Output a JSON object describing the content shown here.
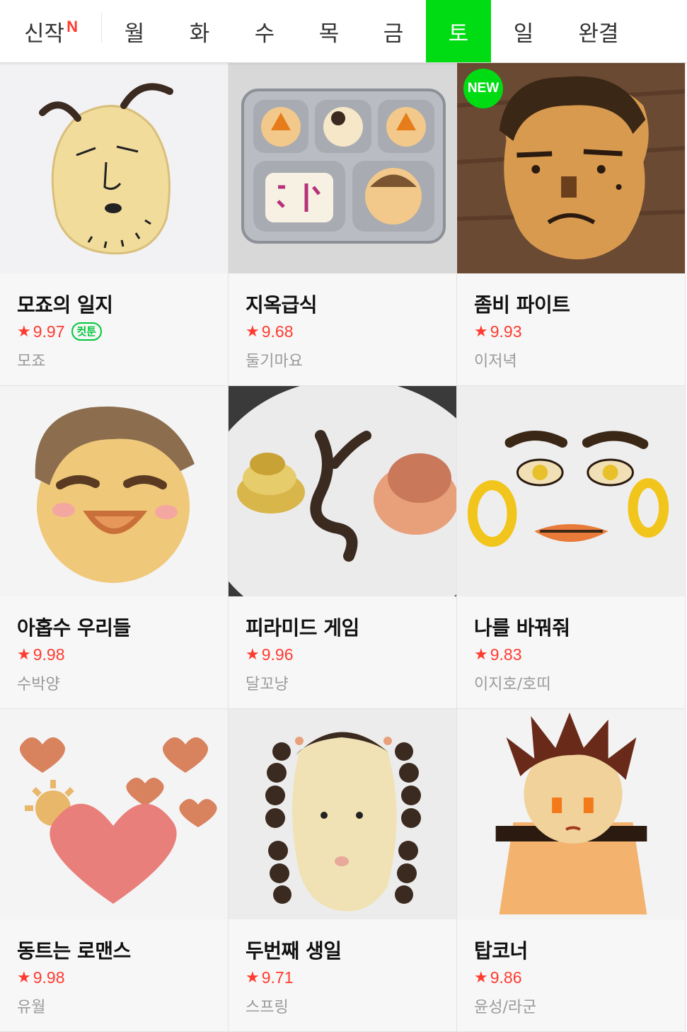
{
  "tabs": {
    "new_label": "신작",
    "new_mark": "N",
    "days": [
      "월",
      "화",
      "수",
      "목",
      "금",
      "토",
      "일",
      "완결"
    ],
    "active": "토"
  },
  "webtoons": [
    {
      "title": "모죠의 일지",
      "rating": "9.97",
      "badge": "컷툰",
      "author": "모죠",
      "thumb": "potato-face-cookie"
    },
    {
      "title": "지옥급식",
      "rating": "9.68",
      "author": "둘기마요",
      "thumb": "lunch-tray-cookies"
    },
    {
      "title": "좀비 파이트",
      "rating": "9.93",
      "author": "이저녁",
      "thumb": "angry-face-cookie",
      "new_label": "NEW"
    },
    {
      "title": "아홉수 우리들",
      "rating": "9.98",
      "author": "수박양",
      "thumb": "smiling-boy-cookie"
    },
    {
      "title": "피라미드 게임",
      "rating": "9.96",
      "author": "달꼬냥",
      "thumb": "plate-cookies"
    },
    {
      "title": "나를 바꿔줘",
      "rating": "9.83",
      "author": "이지호/호띠",
      "thumb": "face-parts-cookies"
    },
    {
      "title": "동트는 로맨스",
      "rating": "9.98",
      "author": "유월",
      "thumb": "heart-cookies"
    },
    {
      "title": "두번째 생일",
      "rating": "9.71",
      "author": "스프링",
      "thumb": "braided-girl-cookie"
    },
    {
      "title": "탑코너",
      "rating": "9.86",
      "author": "윤성/라군",
      "thumb": "spiky-hair-cookie"
    }
  ],
  "colors": {
    "accent": "#00dc14",
    "rating": "#ff3b30",
    "badge": "#00c73c"
  }
}
